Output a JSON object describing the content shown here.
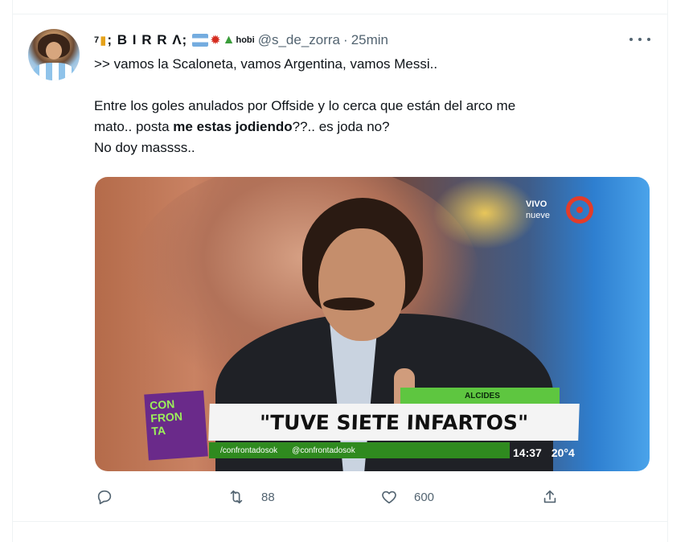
{
  "tweet": {
    "author": {
      "superscript": "7",
      "name": "; B I R R Λ;",
      "badge": "hobi",
      "handle": "@s_de_zorra",
      "separator": "·",
      "time": "25min"
    },
    "lines": [
      ">> vamos la Scaloneta, vamos Argentina, vamos Messi..",
      "Entre los goles anulados por Offside y lo cerca que están del arco me",
      "mato.. posta ",
      "me estas jodiendo",
      "??.. es joda no?",
      "No doy massss.."
    ],
    "media": {
      "channel_live": "VIVO",
      "channel_name": "nueve",
      "show_logo_lines": [
        "CON",
        "FRON",
        "TA"
      ],
      "name_tag": "ALCIDES",
      "headline": "\"TUVE SIETE INFARTOS\"",
      "facebook": "/confrontadosok",
      "twitter": "@confrontadosok",
      "clock": "14:37",
      "temperature": "20°4"
    },
    "actions": {
      "retweets": "88",
      "likes": "600"
    }
  },
  "colors": {
    "text": "#0f1419",
    "secondary": "#536471",
    "border": "#eff3f4"
  },
  "icons": [
    "more-icon",
    "reply-icon",
    "retweet-icon",
    "like-icon",
    "share-icon"
  ]
}
